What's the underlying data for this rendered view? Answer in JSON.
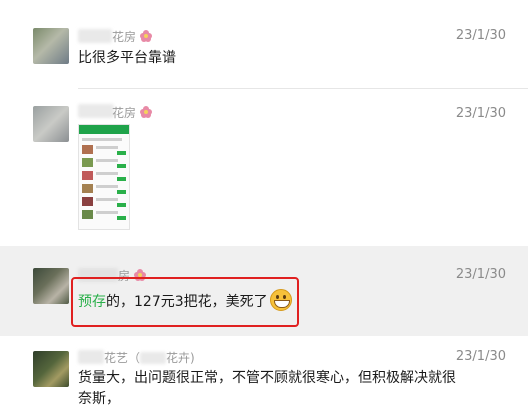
{
  "messages": [
    {
      "name_suffix": "花房",
      "date": "23/1/30",
      "text": "比很多平台靠谱"
    },
    {
      "name_suffix": "花房",
      "date": "23/1/30",
      "attachment": "screenshot-thumbnail"
    },
    {
      "name_suffix": "房",
      "date": "23/1/30",
      "text_green": "预存",
      "text_rest": "的，127元3把花，美死了",
      "emoji": "grin-emoji"
    },
    {
      "name_suffix": "花艺（",
      "name_suffix2": "花卉)",
      "date": "23/1/30",
      "text": "货量大，出问题很正常，不管不顾就很寒心，但积极解决就很奈斯，"
    }
  ],
  "colors": {
    "highlight_row": "#f0f0f0",
    "accent_green": "#2ab04a",
    "annotation_red": "#e02020"
  }
}
